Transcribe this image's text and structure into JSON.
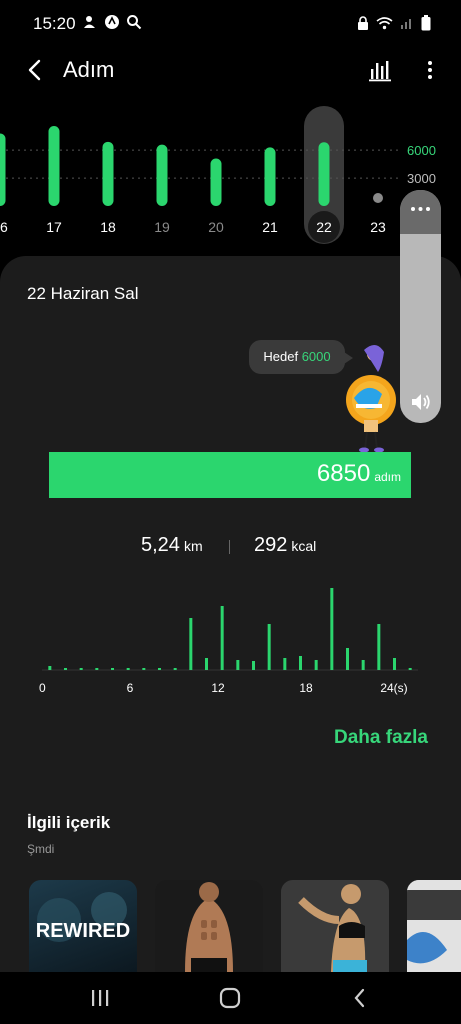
{
  "status": {
    "time": "15:20",
    "left_icons": [
      "notification-icon",
      "app-icon",
      "search-icon"
    ],
    "right_icons": [
      "lock-icon",
      "wifi-icon",
      "signal-icon",
      "battery-icon"
    ]
  },
  "header": {
    "title": "Adım",
    "back_icon": "back-arrow-icon",
    "chart_icon": "bar-chart-icon",
    "more_icon": "more-vertical-icon"
  },
  "chart_data": [
    {
      "type": "bar",
      "categories": [
        "16",
        "17",
        "18",
        "19",
        "20",
        "21",
        "22",
        "23"
      ],
      "values": [
        7800,
        8600,
        6900,
        6600,
        5100,
        6300,
        6850,
        0
      ],
      "selected": "22",
      "reference_lines": [
        {
          "label": "6000",
          "value": 6000,
          "color": "#37d67a"
        },
        {
          "label": "3000",
          "value": 3000,
          "color": "#bdbdbd"
        }
      ],
      "color": "#2bd66e"
    },
    {
      "type": "bar",
      "categories": [
        "0",
        "1",
        "2",
        "3",
        "4",
        "5",
        "6",
        "7",
        "8",
        "9",
        "10",
        "11",
        "12",
        "13",
        "14",
        "15",
        "16",
        "17",
        "18",
        "19",
        "20",
        "21",
        "22",
        "23"
      ],
      "x_ticks": [
        "0",
        "6",
        "12",
        "18",
        "24(s)"
      ],
      "values": [
        40,
        20,
        5,
        5,
        5,
        5,
        10,
        10,
        20,
        520,
        120,
        640,
        100,
        90,
        460,
        120,
        140,
        100,
        820,
        220,
        100,
        460,
        120,
        20
      ],
      "color": "#2bd66e"
    }
  ],
  "card": {
    "date": "22 Haziran Sal",
    "goal_label": "Hedef",
    "goal_value": "6000",
    "steps": "6850",
    "steps_unit": "adım",
    "progress": 1.0,
    "distance": "5,24",
    "distance_unit": "km",
    "calories": "292",
    "calories_unit": "kcal",
    "more_label": "Daha fazla"
  },
  "related": {
    "title": "İlgili içerik",
    "subtitle": "Şmdi",
    "thumbnails": [
      {
        "name": "rewired",
        "text": "REWIRED"
      },
      {
        "name": "abs-workout",
        "text": ""
      },
      {
        "name": "woman-workout",
        "text": ""
      },
      {
        "name": "stretching",
        "text": ""
      }
    ]
  },
  "volume_panel": {
    "icons": [
      "more-horizontal-icon",
      "speaker-icon"
    ]
  },
  "nav": {
    "icons": [
      "recent-apps-icon",
      "home-icon",
      "back-nav-icon"
    ]
  },
  "colors": {
    "accent": "#37d67a",
    "bar": "#2bd66e",
    "card": "#1c1c1c"
  }
}
